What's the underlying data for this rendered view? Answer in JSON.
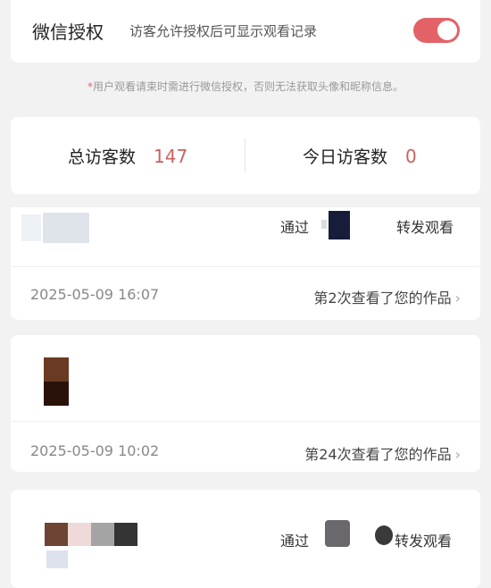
{
  "auth": {
    "title": "微信授权",
    "description": "访客允许授权后可显示观看记录",
    "toggle_on": true,
    "accent": "#e36267"
  },
  "notice": {
    "star": "*",
    "text": "用户观看请束时需进行微信授权，否则无法获取头像和昵称信息。"
  },
  "stats": {
    "total_label": "总访客数",
    "total_value": "147",
    "today_label": "今日访客数",
    "today_value": "0"
  },
  "visitors": [
    {
      "via_prefix": "通过",
      "via_suffix": "转发观看",
      "timestamp": "2025-05-09 16:07",
      "view_text": "第2次查看了您的作品",
      "chevron": "›"
    },
    {
      "timestamp": "2025-05-09 10:02",
      "view_text": "第24次查看了您的作品",
      "chevron": "›"
    },
    {
      "via_prefix": "通过",
      "via_suffix": "转发观看"
    }
  ]
}
